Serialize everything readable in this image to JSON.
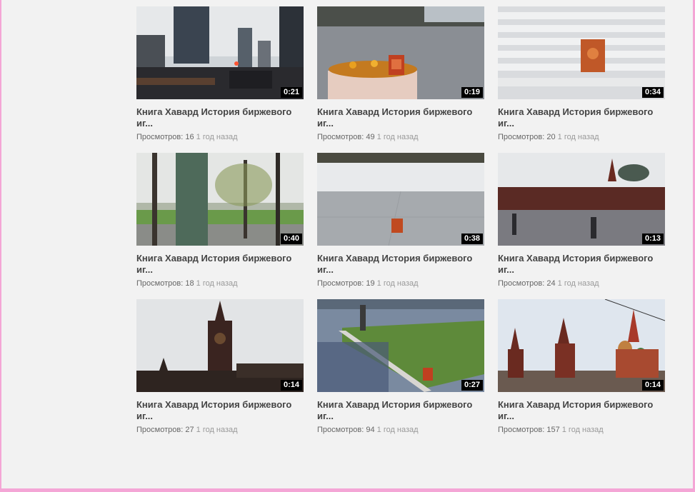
{
  "videos": [
    {
      "title_line1": "Книга Хавард История биржевого",
      "title_line2": "иг...",
      "views_label": "Просмотров:",
      "views": "16",
      "ago": "1 год назад",
      "duration": "0:21"
    },
    {
      "title_line1": "Книга Хавард История биржевого",
      "title_line2": "иг...",
      "views_label": "Просмотров:",
      "views": "49",
      "ago": "1 год назад",
      "duration": "0:19"
    },
    {
      "title_line1": "Книга Хавард История биржевого",
      "title_line2": "иг...",
      "views_label": "Просмотров:",
      "views": "20",
      "ago": "1 год назад",
      "duration": "0:34"
    },
    {
      "title_line1": "Книга Хавард История биржевого",
      "title_line2": "иг...",
      "views_label": "Просмотров:",
      "views": "18",
      "ago": "1 год назад",
      "duration": "0:40"
    },
    {
      "title_line1": "Книга Хавард История биржевого",
      "title_line2": "иг...",
      "views_label": "Просмотров:",
      "views": "19",
      "ago": "1 год назад",
      "duration": "0:38"
    },
    {
      "title_line1": "Книга Хавард История биржевого",
      "title_line2": "иг...",
      "views_label": "Просмотров:",
      "views": "24",
      "ago": "1 год назад",
      "duration": "0:13"
    },
    {
      "title_line1": "Книга Хавард История биржевого",
      "title_line2": "иг...",
      "views_label": "Просмотров:",
      "views": "27",
      "ago": "1 год назад",
      "duration": "0:14"
    },
    {
      "title_line1": "Книга Хавард История биржевого",
      "title_line2": "иг...",
      "views_label": "Просмотров:",
      "views": "94",
      "ago": "1 год назад",
      "duration": "0:27"
    },
    {
      "title_line1": "Книга Хавард История биржевого",
      "title_line2": "иг...",
      "views_label": "Просмотров:",
      "views": "157",
      "ago": "1 год назад",
      "duration": "0:14"
    }
  ],
  "colors": {
    "background": "#f2f2f2",
    "frame": "#f4a6d6",
    "title": "#444444",
    "meta": "#666666",
    "ago": "#999999"
  }
}
